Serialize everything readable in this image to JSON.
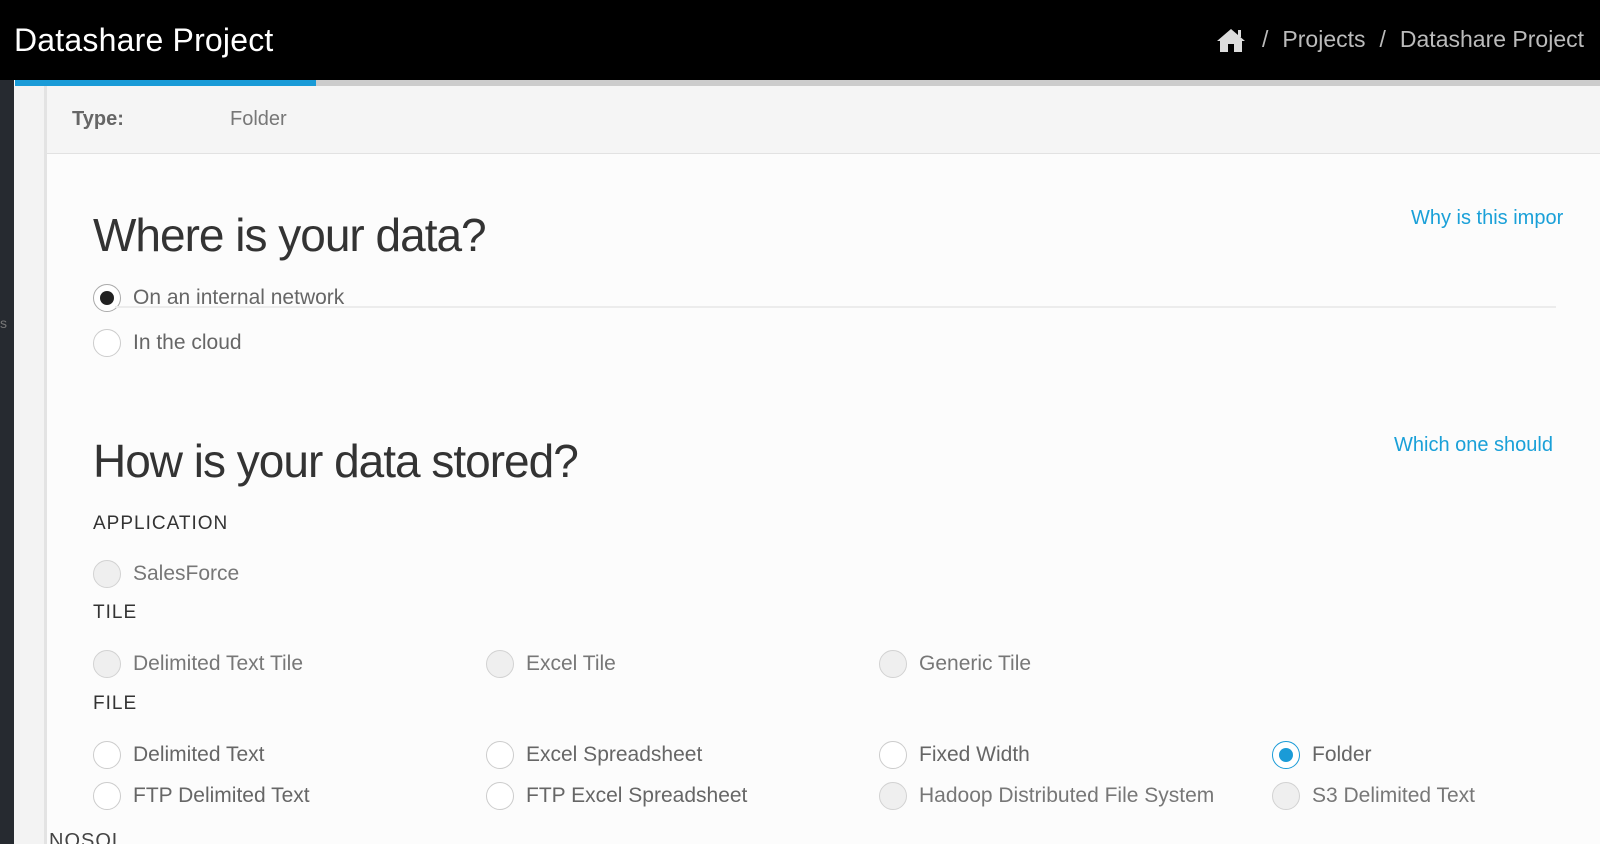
{
  "header": {
    "title": "Datashare Project",
    "breadcrumb": {
      "home_icon": "home-icon",
      "separator": "/",
      "items": [
        "Projects",
        "Datashare Project"
      ]
    }
  },
  "progress": {
    "percent": 19
  },
  "rail": {
    "glyph": "s"
  },
  "type_strip": {
    "label": "Type:",
    "value": "Folder"
  },
  "location": {
    "heading": "Where is your data?",
    "help_link": "Why is this impor",
    "options": [
      {
        "label": "On an internal network",
        "selected": true
      },
      {
        "label": "In the cloud",
        "selected": false
      }
    ]
  },
  "storage": {
    "heading": "How is your data stored?",
    "help_link": "Which one should",
    "groups": [
      {
        "label": "APPLICATION",
        "options": [
          "SalesForce"
        ]
      },
      {
        "label": "TILE",
        "options": [
          "Delimited Text Tile",
          "Excel Tile",
          "Generic Tile"
        ]
      },
      {
        "label": "FILE",
        "options": [
          "Delimited Text",
          "Excel Spreadsheet",
          "Fixed Width",
          "Folder",
          "FTP Delimited Text",
          "FTP Excel Spreadsheet",
          "Hadoop Distributed File System",
          "S3 Delimited Text"
        ],
        "selected": "Folder"
      }
    ],
    "next_group_partial": "NOSQL"
  },
  "colors": {
    "accent": "#1a9bd7",
    "topbar": "#000000",
    "link": "#1aa0d8"
  }
}
